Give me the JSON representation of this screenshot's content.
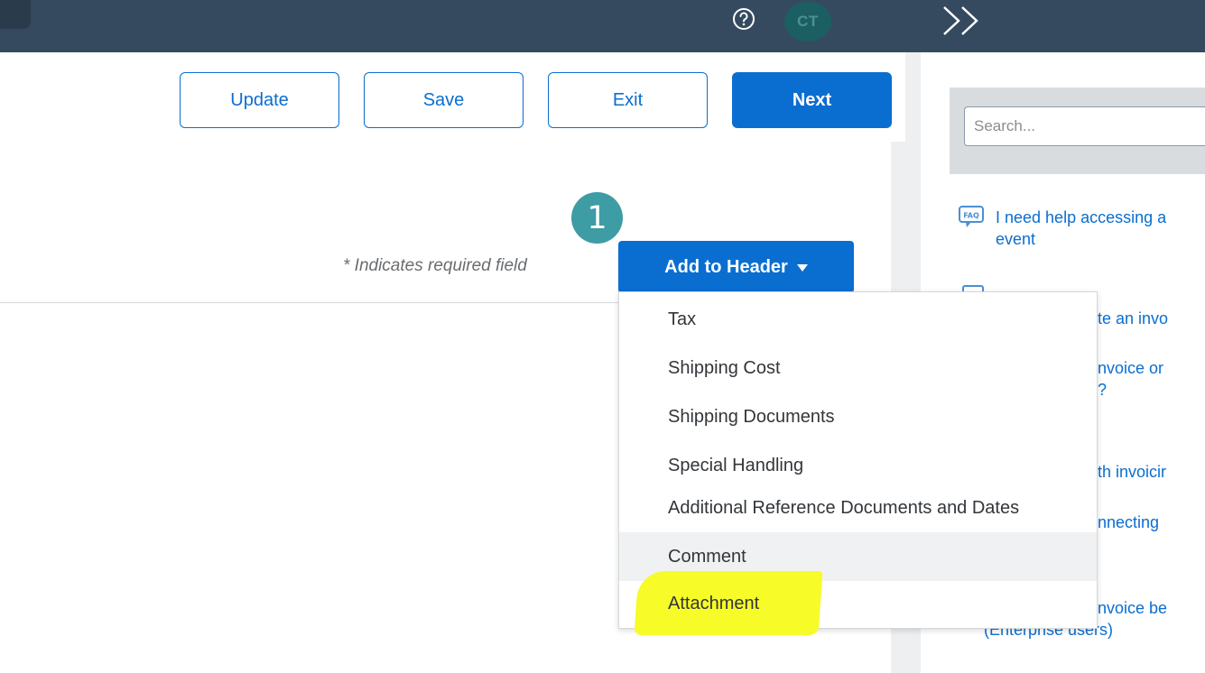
{
  "header": {
    "avatar_initials": "CT",
    "help_icon": "help-circle-icon",
    "expand_icon": "double-chevron-right-icon"
  },
  "toolbar": {
    "update_label": "Update",
    "save_label": "Save",
    "exit_label": "Exit",
    "next_label": "Next"
  },
  "form": {
    "step_number": "1",
    "required_note": "* Indicates required field",
    "add_to_header_label": "Add to Header"
  },
  "dropdown": {
    "items": [
      {
        "label": "Tax"
      },
      {
        "label": "Shipping Cost"
      },
      {
        "label": "Shipping Documents"
      },
      {
        "label": "Special Handling"
      },
      {
        "label": "Additional Reference Documents and Dates"
      },
      {
        "label": "Comment"
      },
      {
        "label": "Attachment"
      }
    ],
    "hovered_item": "Comment",
    "highlighted_item": "Attachment"
  },
  "help_panel": {
    "search_placeholder": "Search...",
    "links": [
      {
        "line1": "I need help accessing a",
        "line2": "event"
      },
      {
        "line1": "te an invo"
      },
      {
        "line1": "nvoice or",
        "line2": "?"
      },
      {
        "line1": "th invoicir"
      },
      {
        "line1": "nnecting"
      },
      {
        "line1": "nvoice be",
        "line2": "(Enterprise users)"
      }
    ]
  },
  "colors": {
    "topbar": "#354a5f",
    "accent": "#0a6ed1",
    "step_badge": "#3e9ca5",
    "highlight": "#f7fb27"
  }
}
